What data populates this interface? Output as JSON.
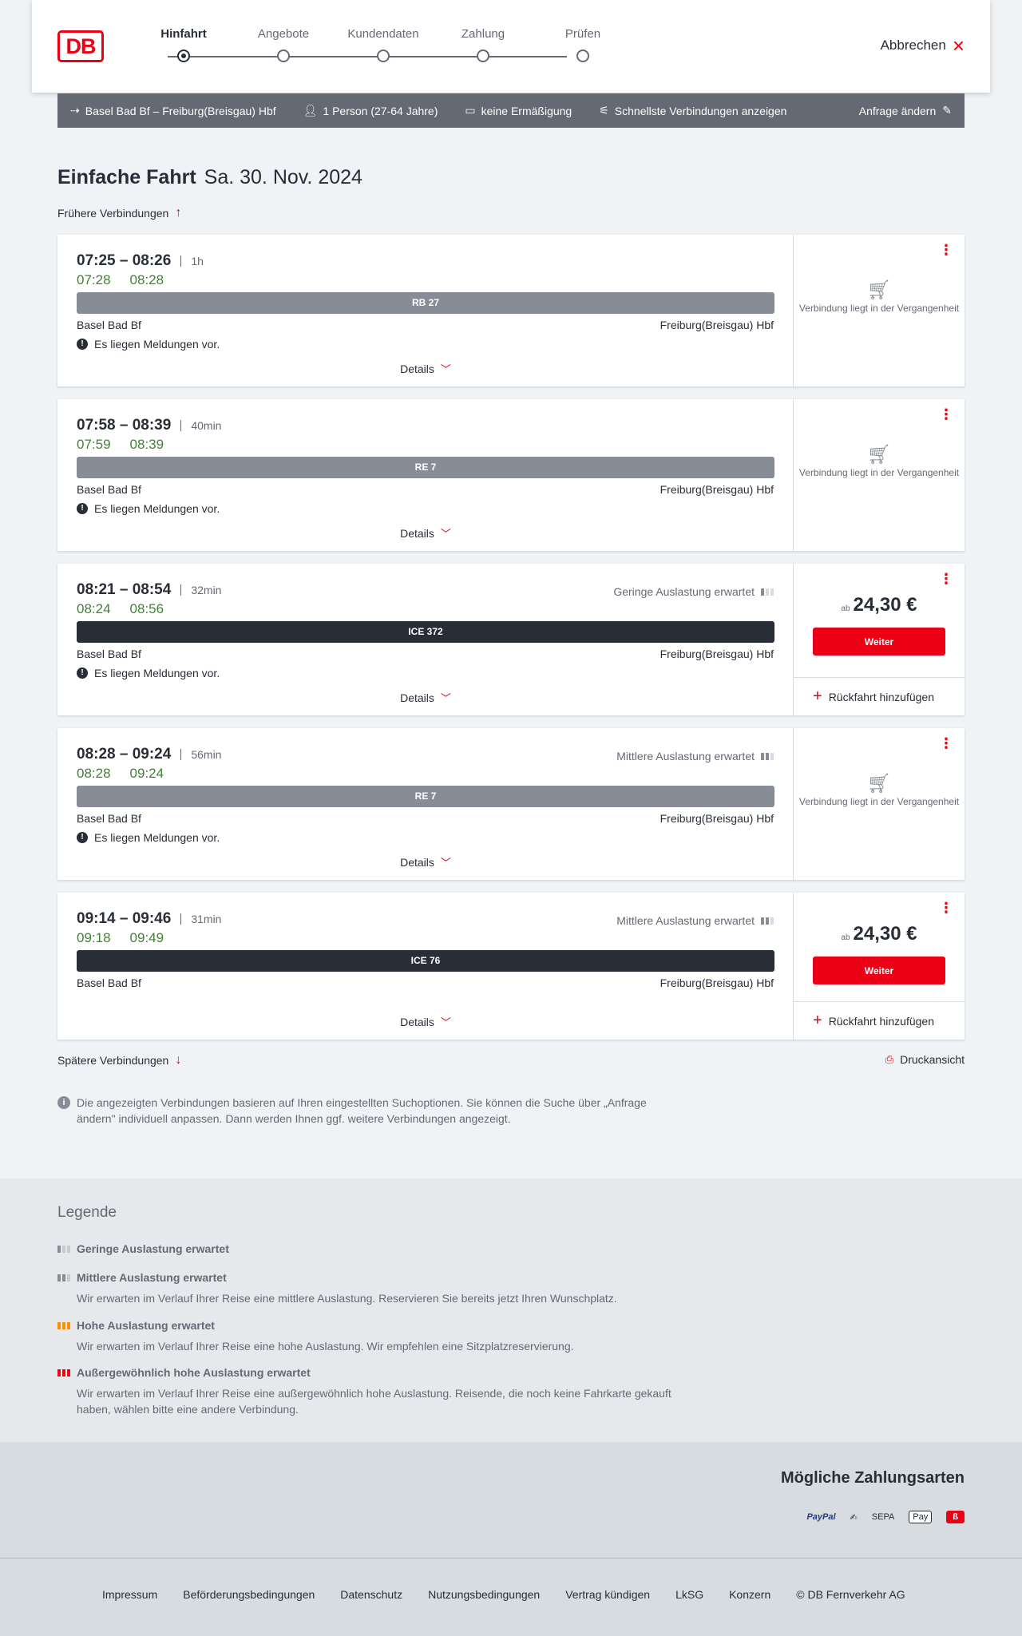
{
  "header": {
    "logo": "DB",
    "steps": [
      {
        "label": "Hinfahrt",
        "active": true
      },
      {
        "label": "Angebote",
        "active": false
      },
      {
        "label": "Kundendaten",
        "active": false
      },
      {
        "label": "Zahlung",
        "active": false
      },
      {
        "label": "Prüfen",
        "active": false
      }
    ],
    "cancel_label": "Abbrechen"
  },
  "summary": {
    "route": "Basel Bad Bf – Freiburg(Breisgau) Hbf",
    "passengers": "1 Person (27-64 Jahre)",
    "discount": "keine Ermäßigung",
    "fastest": "Schnellste Verbindungen anzeigen",
    "edit": "Anfrage ändern"
  },
  "title": {
    "trip_type": "Einfache Fahrt",
    "date": "Sa. 30. Nov. 2024"
  },
  "earlier_label": "Frühere Verbindungen",
  "later_label": "Spätere Verbindungen",
  "print_label": "Druckansicht",
  "connections": [
    {
      "times": "07:25 – 08:26",
      "duration": "1h",
      "real_dep": "07:28",
      "real_arr": "08:28",
      "train": "RB 27",
      "from": "Basel Bad Bf",
      "to": "Freiburg(Breisgau) Hbf",
      "message": "Es liegen Meldungen vor.",
      "details": "Details",
      "past_text": "Verbindung liegt in der Vergangenheit"
    },
    {
      "times": "07:58 – 08:39",
      "duration": "40min",
      "real_dep": "07:59",
      "real_arr": "08:39",
      "train": "RE 7",
      "from": "Basel Bad Bf",
      "to": "Freiburg(Breisgau) Hbf",
      "message": "Es liegen Meldungen vor.",
      "details": "Details",
      "past_text": "Verbindung liegt in der Vergangenheit"
    },
    {
      "times": "08:21 – 08:54",
      "duration": "32min",
      "load": "Geringe Auslastung erwartet",
      "real_dep": "08:24",
      "real_arr": "08:56",
      "train": "ICE 372",
      "from": "Basel Bad Bf",
      "to": "Freiburg(Breisgau) Hbf",
      "message": "Es liegen Meldungen vor.",
      "details": "Details",
      "price_prefix": "ab",
      "price": "24,30 €",
      "button": "Weiter",
      "return_label": "Rückfahrt hinzufügen"
    },
    {
      "times": "08:28 – 09:24",
      "duration": "56min",
      "load": "Mittlere Auslastung erwartet",
      "real_dep": "08:28",
      "real_arr": "09:24",
      "train": "RE 7",
      "from": "Basel Bad Bf",
      "to": "Freiburg(Breisgau) Hbf",
      "message": "Es liegen Meldungen vor.",
      "details": "Details",
      "past_text": "Verbindung liegt in der Vergangenheit"
    },
    {
      "times": "09:14 – 09:46",
      "duration": "31min",
      "load": "Mittlere Auslastung erwartet",
      "real_dep": "09:18",
      "real_arr": "09:49",
      "train": "ICE 76",
      "from": "Basel Bad Bf",
      "to": "Freiburg(Breisgau) Hbf",
      "details": "Details",
      "price_prefix": "ab",
      "price": "24,30 €",
      "button": "Weiter",
      "return_label": "Rückfahrt hinzufügen"
    }
  ],
  "info_text": "Die angezeigten Verbindungen basieren auf Ihren eingestellten Suchoptionen. Sie können die Suche über „Anfrage ändern\" individuell anpassen. Dann werden Ihnen ggf. weitere Verbindungen angezeigt.",
  "legend": {
    "title": "Legende",
    "items": [
      {
        "head": "Geringe Auslastung erwartet"
      },
      {
        "head": "Mittlere Auslastung erwartet",
        "text": "Wir erwarten im Verlauf Ihrer Reise eine mittlere Auslastung. Reservieren Sie bereits jetzt Ihren Wunschplatz."
      },
      {
        "head": "Hohe Auslastung erwartet",
        "text": "Wir erwarten im Verlauf Ihrer Reise eine hohe Auslastung. Wir empfehlen eine Sitzplatzreservierung."
      },
      {
        "head": "Außergewöhnlich hohe Auslastung erwartet",
        "text": "Wir erwarten im Verlauf Ihrer Reise eine außergewöhnlich hohe Auslastung. Reisende, die noch keine Fahrkarte gekauft haben, wählen bitte eine andere Verbindung."
      }
    ]
  },
  "payment": {
    "title": "Mögliche Zahlungsarten",
    "paypal": "PayPal",
    "sepa": "SEPA",
    "applepay": "Pay",
    "colors": {
      "brand_red": "#ec0016",
      "realtime_green": "#408335"
    }
  },
  "footer": [
    "Impressum",
    "Beförderungsbedingungen",
    "Datenschutz",
    "Nutzungsbedingungen",
    "Vertrag kündigen",
    "LkSG",
    "Konzern",
    "© DB Fernverkehr AG"
  ]
}
